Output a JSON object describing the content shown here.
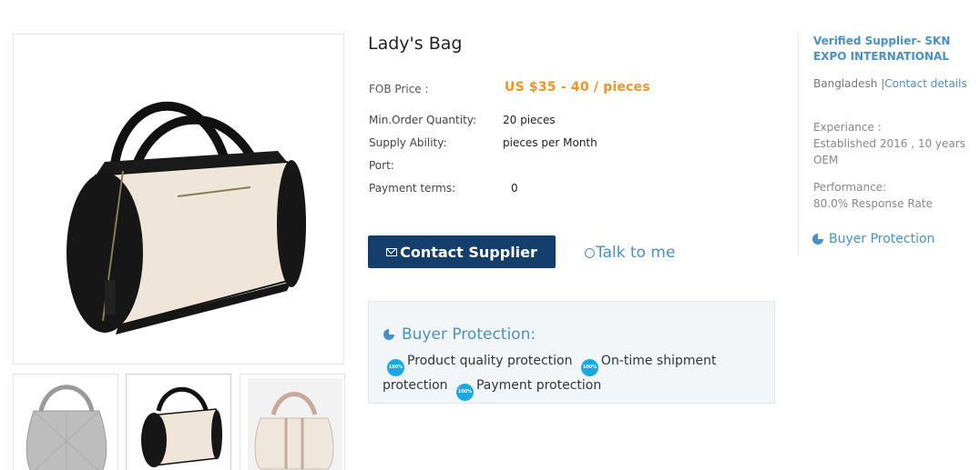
{
  "product": {
    "title": "Lady's Bag",
    "fob_label": "FOB Price :",
    "price": "US $35 - 40 / pieces"
  },
  "specs": [
    {
      "label": "Min.Order Quantity:",
      "value": "20 pieces"
    },
    {
      "label": "Supply Ability:",
      "value": "pieces per Month"
    },
    {
      "label": "Port:",
      "value": ""
    },
    {
      "label": "Payment terms:",
      "value": "0"
    }
  ],
  "actions": {
    "contact_label": "Contact Supplier",
    "talk_label": "Talk to me"
  },
  "buyer_protection": {
    "heading": "Buyer Protection:",
    "badge_text": "100%",
    "items": [
      "Product quality protection",
      "On-time shipment protection",
      "Payment protection"
    ]
  },
  "supplier": {
    "name": "Verified Supplier- SKN EXPO INTERNATIONAL",
    "country": "Bangladesh",
    "contact_link": "Contact details",
    "experience_label": "Experiance :",
    "experience_value": "Established 2016 , 10 years",
    "experience_type": "OEM",
    "performance_label": "Performance:",
    "performance_value": "80.0% Response Rate",
    "buyer_protection_label": "Buyer Protection"
  },
  "colors": {
    "brand_blue": "#143e6b",
    "link_blue": "#4a90c8",
    "price_orange": "#f0932b",
    "badge_cyan": "#1ba8e0"
  }
}
